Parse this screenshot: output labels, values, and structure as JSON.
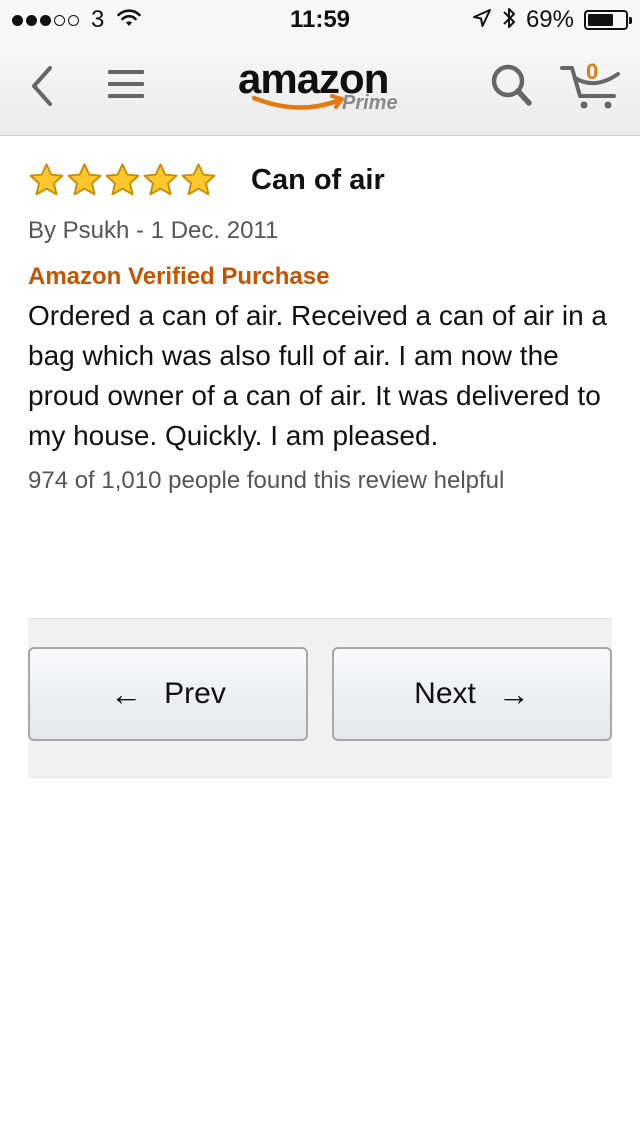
{
  "status_bar": {
    "signal_dots_filled": 3,
    "signal_dots_total": 5,
    "carrier": "3",
    "time": "11:59",
    "battery_percent": "69%",
    "battery_level": 0.69,
    "icons": [
      "wifi-icon",
      "location-icon",
      "bluetooth-icon",
      "battery-icon"
    ]
  },
  "header": {
    "logo_text": "amazon",
    "logo_subtext": "Prime",
    "cart_count": "0",
    "icons": [
      "back-chevron-icon",
      "menu-icon",
      "search-icon",
      "cart-icon"
    ],
    "accent_color": "#e47911"
  },
  "review": {
    "rating": 5,
    "rating_max": 5,
    "title": "Can of air",
    "byline": "By Psukh - 1 Dec. 2011",
    "verified_label": "Amazon Verified Purchase",
    "verified_color": "#c45500",
    "body": "Ordered a can of air. Received a can of air in a bag which was also full of air. I am now the proud owner of a can of air. It was delivered to my house. Quickly. I am pleased.",
    "helpful_text": "974 of 1,010 people found this review helpful"
  },
  "pager": {
    "prev_label": "Prev",
    "prev_arrow": "←",
    "next_label": "Next",
    "next_arrow": "→"
  }
}
